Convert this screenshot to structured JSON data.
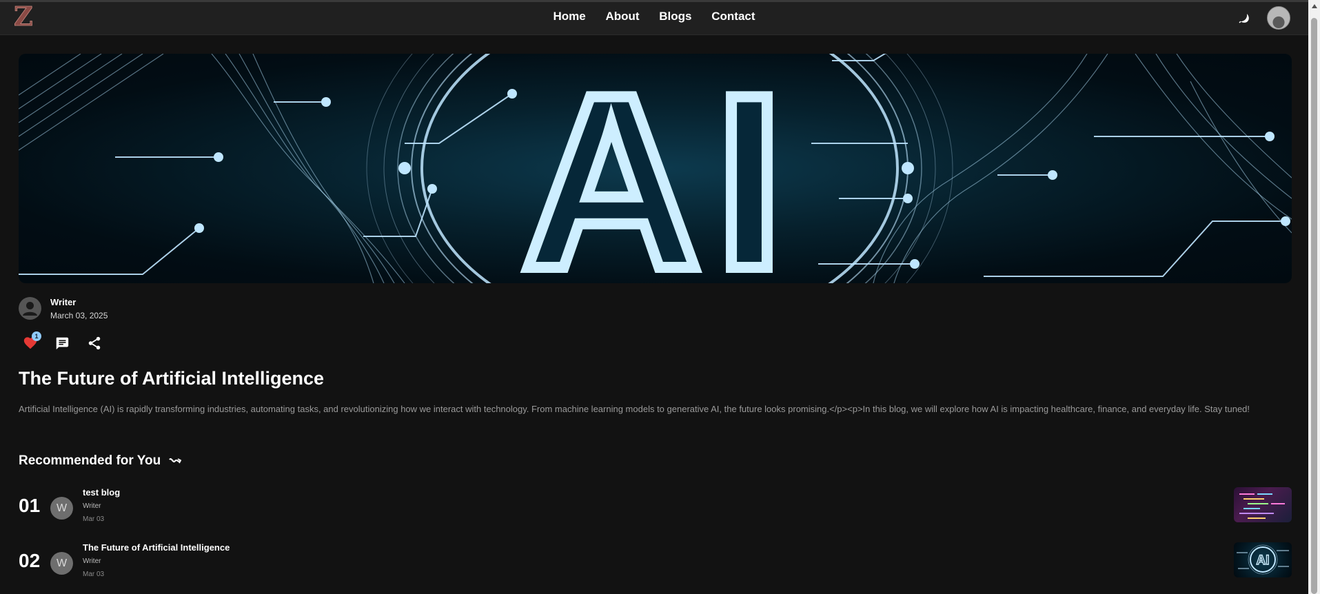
{
  "header": {
    "logo_letter": "Z",
    "nav": [
      "Home",
      "About",
      "Blogs",
      "Contact"
    ]
  },
  "hero": {
    "image_text": "AI"
  },
  "post": {
    "author": "Writer",
    "date": "March 03, 2025",
    "likes": "1",
    "title": "The Future of Artificial Intelligence",
    "body": "Artificial Intelligence (AI) is rapidly transforming industries, automating tasks, and revolutionizing how we interact with technology. From machine learning models to generative AI, the future looks promising.</p><p>In this blog, we will explore how AI is impacting healthcare, finance, and everyday life. Stay tuned!"
  },
  "recommended": {
    "heading": "Recommended for You",
    "items": [
      {
        "rank": "01",
        "initial": "W",
        "title": "test blog",
        "author": "Writer",
        "date": "Mar 03"
      },
      {
        "rank": "02",
        "initial": "W",
        "title": "The Future of Artificial Intelligence",
        "author": "Writer",
        "date": "Mar 03"
      }
    ]
  },
  "colors": {
    "background": "#121212",
    "header": "#202020",
    "like": "#e53935",
    "badge": "#90caf9",
    "accent_glow": "#bfe6ff"
  },
  "icons": [
    "logo-icon",
    "moon-icon",
    "user-avatar",
    "person-icon",
    "heart-icon",
    "comment-icon",
    "share-icon",
    "trending-icon"
  ]
}
